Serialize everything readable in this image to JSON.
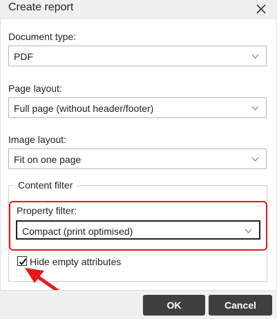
{
  "dialog": {
    "title": "Create report",
    "close_icon": "close-icon"
  },
  "fields": {
    "document_type": {
      "label": "Document type:",
      "value": "PDF"
    },
    "page_layout": {
      "label": "Page layout:",
      "value": "Full page (without header/footer)"
    },
    "image_layout": {
      "label": "Image layout:",
      "value": "Fit on one page"
    }
  },
  "content_filter": {
    "legend": "Content filter",
    "property_filter": {
      "label": "Property filter:",
      "value": "Compact (print optimised)"
    },
    "hide_empty": {
      "label": "Hide empty attributes",
      "checked": true
    }
  },
  "buttons": {
    "ok": "OK",
    "cancel": "Cancel"
  },
  "colors": {
    "highlight": "#e8191c",
    "button_bg": "#3f3f3f",
    "titlebar_bg": "#f0f0f0"
  }
}
